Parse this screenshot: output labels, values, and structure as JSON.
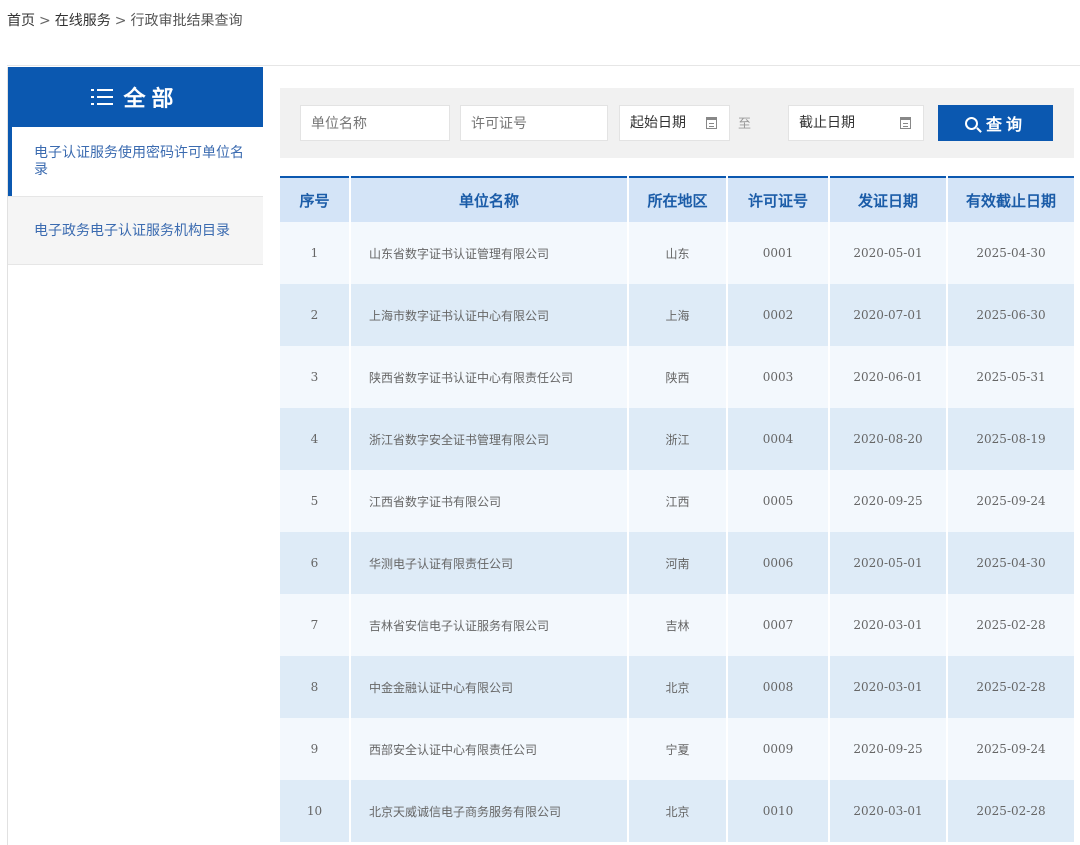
{
  "breadcrumb": {
    "items": [
      "首页",
      "在线服务",
      "行政审批结果查询"
    ],
    "separator": ">"
  },
  "sidebar": {
    "title": "全部",
    "icon": "list-icon",
    "items": [
      {
        "label": "电子认证服务使用密码许可单位名录",
        "active": true
      },
      {
        "label": "电子政务电子认证服务机构目录",
        "active": false
      }
    ]
  },
  "search": {
    "unit_placeholder": "单位名称",
    "license_placeholder": "许可证号",
    "start_placeholder": "起始日期",
    "to_label": "至",
    "end_placeholder": "截止日期",
    "button_label": "查询"
  },
  "table": {
    "headers": [
      "序号",
      "单位名称",
      "所在地区",
      "许可证号",
      "发证日期",
      "有效截止日期"
    ],
    "rows": [
      [
        "1",
        "山东省数字证书认证管理有限公司",
        "山东",
        "0001",
        "2020-05-01",
        "2025-04-30"
      ],
      [
        "2",
        "上海市数字证书认证中心有限公司",
        "上海",
        "0002",
        "2020-07-01",
        "2025-06-30"
      ],
      [
        "3",
        "陕西省数字证书认证中心有限责任公司",
        "陕西",
        "0003",
        "2020-06-01",
        "2025-05-31"
      ],
      [
        "4",
        "浙江省数字安全证书管理有限公司",
        "浙江",
        "0004",
        "2020-08-20",
        "2025-08-19"
      ],
      [
        "5",
        "江西省数字证书有限公司",
        "江西",
        "0005",
        "2020-09-25",
        "2025-09-24"
      ],
      [
        "6",
        "华测电子认证有限责任公司",
        "河南",
        "0006",
        "2020-05-01",
        "2025-04-30"
      ],
      [
        "7",
        "吉林省安信电子认证服务有限公司",
        "吉林",
        "0007",
        "2020-03-01",
        "2025-02-28"
      ],
      [
        "8",
        "中金金融认证中心有限公司",
        "北京",
        "0008",
        "2020-03-01",
        "2025-02-28"
      ],
      [
        "9",
        "西部安全认证中心有限责任公司",
        "宁夏",
        "0009",
        "2020-09-25",
        "2025-09-24"
      ],
      [
        "10",
        "北京天威诚信电子商务服务有限公司",
        "北京",
        "0010",
        "2020-03-01",
        "2025-02-28"
      ]
    ]
  },
  "colors": {
    "primary": "#0b58b0",
    "header_bg": "#d4e4f7",
    "row_light": "#f3f8fd",
    "row_dark": "#deebf7"
  }
}
